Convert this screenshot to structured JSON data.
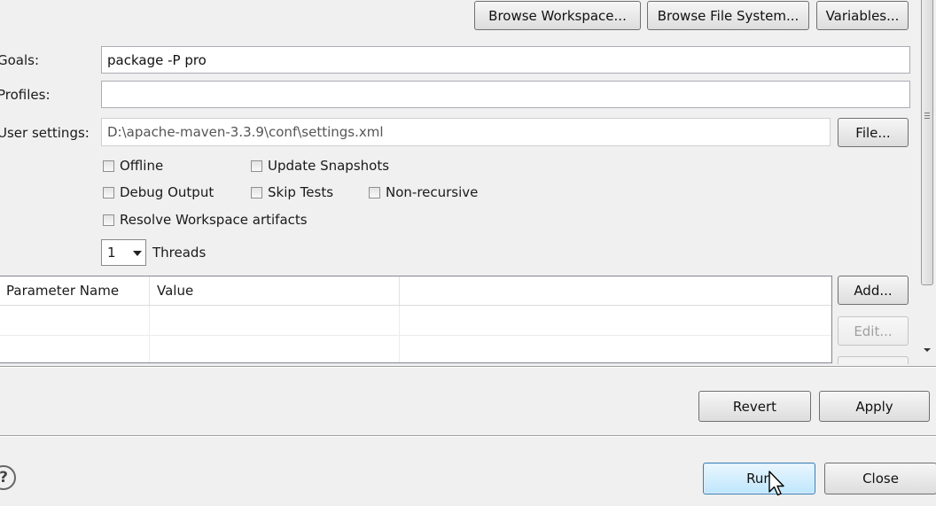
{
  "top_buttons": {
    "browse_workspace": "Browse Workspace...",
    "browse_file_system": "Browse File System...",
    "variables": "Variables..."
  },
  "form": {
    "goals_label": "Goals:",
    "goals_value": "package -P pro",
    "profiles_label": "Profiles:",
    "profiles_value": "",
    "user_settings_label": "User settings:",
    "user_settings_value": "D:\\apache-maven-3.3.9\\conf\\settings.xml",
    "file_button": "File..."
  },
  "options": {
    "offline": "Offline",
    "update_snapshots": "Update Snapshots",
    "debug_output": "Debug Output",
    "skip_tests": "Skip Tests",
    "non_recursive": "Non-recursive",
    "resolve_workspace": "Resolve Workspace artifacts",
    "threads_value": "1",
    "threads_label": "Threads"
  },
  "params_table": {
    "col_name": "Parameter Name",
    "col_value": "Value",
    "add_button": "Add...",
    "edit_button": "Edit..."
  },
  "actions": {
    "revert": "Revert",
    "apply": "Apply",
    "run": "Run",
    "close": "Close",
    "help_glyph": "?"
  }
}
